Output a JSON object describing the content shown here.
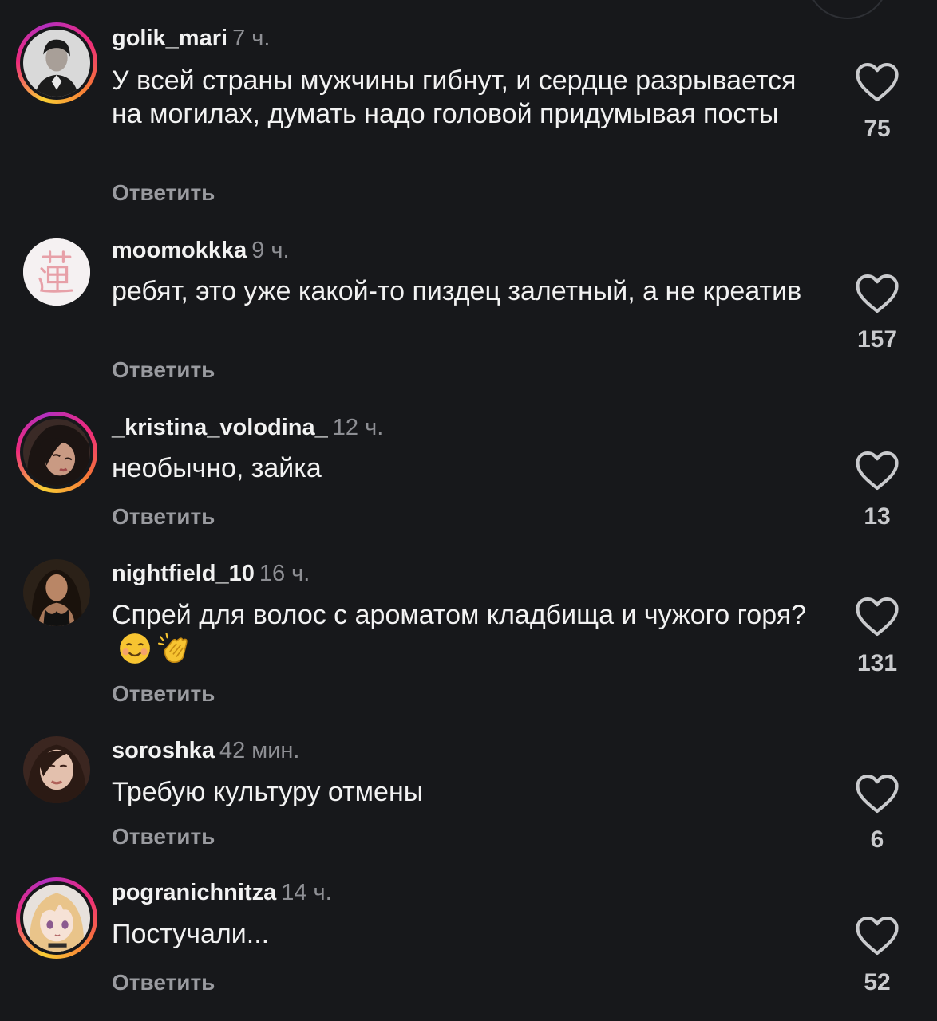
{
  "reply_label": "Ответить",
  "comments": [
    {
      "username": "golik_mari",
      "time": "7 ч.",
      "text": "У всей страны мужчины гибнут, и сердце разрывается на могилах, думать надо головой придумывая посты",
      "likes": "75",
      "avatar_icon": "woman-portrait-bw-icon"
    },
    {
      "username": "moomokkka",
      "time": "9 ч.",
      "text": "ребят, это уже какой-то пиздец залетный, а не креатив",
      "likes": "157",
      "avatar_icon": "hieroglyph-icon"
    },
    {
      "username": "_kristina_volodina_",
      "time": "12 ч.",
      "text": "необычно, зайка",
      "likes": "13",
      "avatar_icon": "woman-portrait-icon"
    },
    {
      "username": "nightfield_10",
      "time": "16 ч.",
      "text": "Спрей для волос с ароматом кладбища и чужого горя?",
      "emojis": [
        "☺️",
        "👏"
      ],
      "likes": "131",
      "avatar_icon": "woman-portrait-icon"
    },
    {
      "username": "soroshka",
      "time": "42 мин.",
      "text": "Требую культуру отмены",
      "likes": "6",
      "avatar_icon": "woman-portrait-icon"
    },
    {
      "username": "pogranichnitza",
      "time": "14 ч.",
      "text": "Постучали...",
      "likes": "52",
      "avatar_icon": "anime-girl-icon"
    }
  ],
  "colors": {
    "background": "#17181b",
    "username": "#f2f2f2",
    "meta": "#8e8f94",
    "reply": "#9a9ba0"
  }
}
